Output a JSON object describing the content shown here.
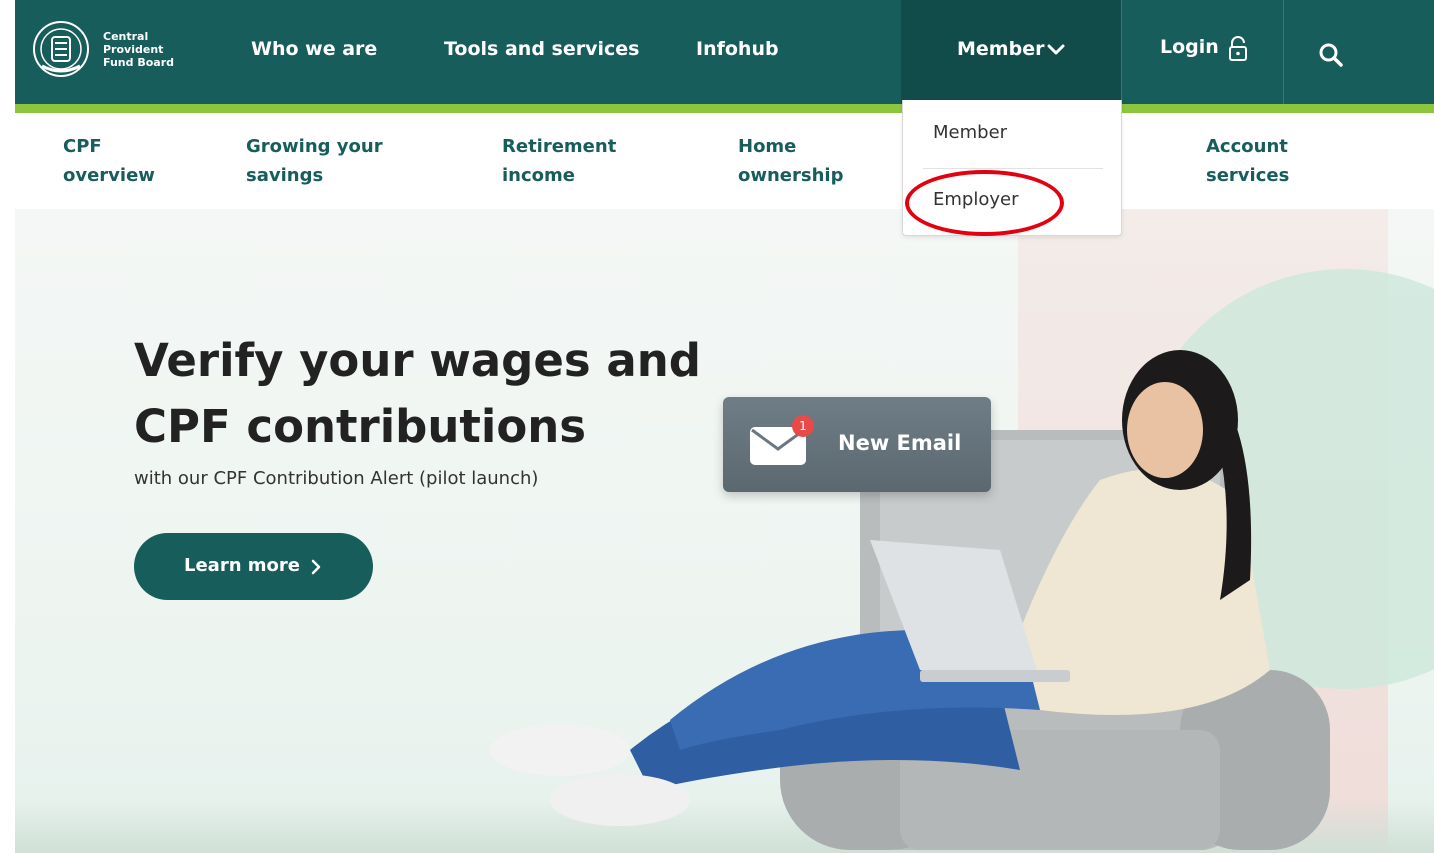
{
  "brand": {
    "name_lines": [
      "Central",
      "Provident",
      "Fund Board"
    ],
    "logo_icon": "cpf-crest-icon",
    "primary_color": "#175d5b",
    "accent_color": "#8cc63f"
  },
  "topnav": {
    "items": [
      "Who we are",
      "Tools and services",
      "Infohub"
    ],
    "member_label": "Member",
    "login_label": "Login",
    "icons": {
      "member": "chevron-down-icon",
      "login": "lock-icon",
      "search": "search-icon"
    }
  },
  "dropdown": {
    "options": [
      "Member",
      "Employer"
    ],
    "highlighted": "Employer",
    "highlight_color": "#e3000f"
  },
  "subnav": {
    "items": [
      {
        "lines": [
          "CPF",
          "overview"
        ]
      },
      {
        "lines": [
          "Growing your",
          "savings"
        ]
      },
      {
        "lines": [
          "Retirement",
          "income"
        ]
      },
      {
        "lines": [
          "Home",
          "ownership"
        ]
      },
      {
        "lines": [
          "Account",
          "services"
        ]
      }
    ]
  },
  "hero": {
    "title_lines": [
      "Verify your wages and",
      "CPF contributions"
    ],
    "subtitle": "with our CPF Contribution Alert (pilot launch)",
    "cta_label": "Learn more",
    "email_card": {
      "label": "New Email",
      "badge_count": "1",
      "icon": "envelope-icon"
    }
  }
}
